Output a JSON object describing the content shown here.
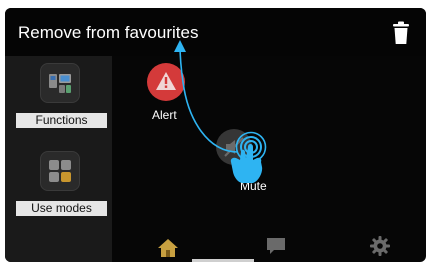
{
  "header": {
    "title": "Remove from favourites",
    "delete_icon": "trash-icon"
  },
  "sidebar": {
    "items": [
      {
        "label": "Functions",
        "icon": "functions-icon"
      },
      {
        "label": "Use modes",
        "icon": "use-modes-icon"
      }
    ]
  },
  "favourites": [
    {
      "label": "Alert",
      "icon": "alert-triangle-icon",
      "color": "#d43a3a"
    },
    {
      "label": "Mute",
      "icon": "mute-icon"
    }
  ],
  "bottom_nav": [
    {
      "icon": "home-icon",
      "color": "#c8a040"
    },
    {
      "icon": "chat-icon",
      "color": "#6a6a6a"
    },
    {
      "icon": "gear-icon",
      "color": "#6a6a6a"
    }
  ],
  "gesture": {
    "icon": "hand-pointer-icon",
    "color": "#2eb4f2"
  },
  "colors": {
    "background": "#060606",
    "sidebar": "#1a1a1a",
    "accent_blue": "#2eb4f2",
    "alert_red": "#d43a3a"
  }
}
